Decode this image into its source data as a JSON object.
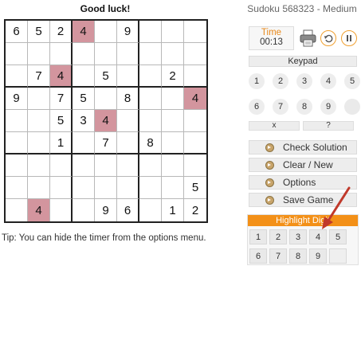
{
  "header": {
    "status": "Good luck!",
    "title": "Sudoku 568323 - Medium"
  },
  "grid": [
    [
      "6",
      "5",
      "2",
      "4",
      "",
      "9",
      "",
      "",
      ""
    ],
    [
      "",
      "",
      "",
      "",
      "",
      "",
      "",
      "",
      ""
    ],
    [
      "",
      "7",
      "4",
      "",
      "5",
      "",
      "",
      "2",
      ""
    ],
    [
      "9",
      "",
      "7",
      "5",
      "",
      "8",
      "",
      "",
      "4"
    ],
    [
      "",
      "",
      "5",
      "3",
      "4",
      "",
      "",
      "",
      ""
    ],
    [
      "",
      "",
      "1",
      "",
      "7",
      "",
      "8",
      "",
      ""
    ],
    [
      "",
      "",
      "",
      "",
      "",
      "",
      "",
      "",
      ""
    ],
    [
      "",
      "",
      "",
      "",
      "",
      "",
      "",
      "",
      "5"
    ],
    [
      "",
      "4",
      "",
      "",
      "9",
      "6",
      "",
      "1",
      "2"
    ]
  ],
  "highlight_digit": "4",
  "highlight_color": "#d3959e",
  "tip": "Tip: You can hide the timer from the options menu.",
  "timer": {
    "label": "Time",
    "value": "00:13"
  },
  "icons": {
    "print": "printer-icon",
    "undo": "undo-icon",
    "pause": "pause-icon"
  },
  "keypad": {
    "title": "Keypad",
    "row1": [
      "1",
      "2",
      "3",
      "4",
      "5"
    ],
    "row2": [
      "6",
      "7",
      "8",
      "9",
      ""
    ],
    "clear": "x",
    "hint": "?"
  },
  "menu": {
    "check": "Check Solution",
    "clear": "Clear / New",
    "options": "Options",
    "save": "Save Game"
  },
  "highlight": {
    "title": "Highlight Digit",
    "row1": [
      "1",
      "2",
      "3",
      "4",
      "5"
    ],
    "row2": [
      "6",
      "7",
      "8",
      "9",
      ""
    ]
  },
  "accent_color": "#f39018"
}
